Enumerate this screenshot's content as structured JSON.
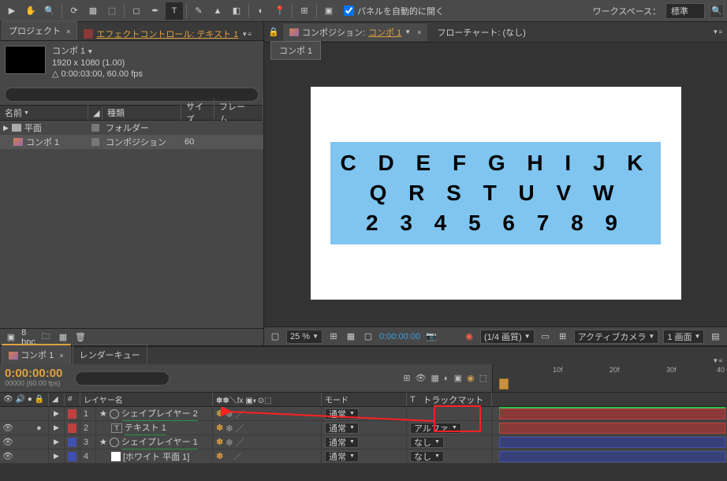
{
  "toolbar": {
    "auto_open_label": "パネルを自動的に開く",
    "workspace_label": "ワークスペース：",
    "workspace_value": "標準"
  },
  "project": {
    "tab_label": "プロジェクト",
    "fx_tab_label": "エフェクトコントロール: テキスト 1",
    "comp_name": "コンポ 1",
    "dimensions": "1920 x 1080 (1.00)",
    "duration": "0:00:03:00, 60.00 fps",
    "columns": {
      "name": "名前",
      "type": "種類",
      "size": "サイズ",
      "frame": "フレーム..."
    },
    "items": [
      {
        "name": "平面",
        "type": "フォルダー",
        "size": "",
        "kind": "folder"
      },
      {
        "name": "コンポ 1",
        "type": "コンポジション",
        "size": "60",
        "kind": "comp"
      }
    ],
    "bpc": "8 bpc"
  },
  "composition": {
    "tab_prefix": "コンポジション:",
    "tab_comp": "コンポ 1",
    "flowchart": "フローチャート: (なし)",
    "subtab": "コンポ 1",
    "text_lines": [
      "C D E F G H I J K",
      "Q R S T U V W",
      "2 3 4 5 6 7 8 9"
    ]
  },
  "viewer_footer": {
    "zoom": "25 %",
    "time": "0:00:00:00",
    "quality": "(1/4 画質)",
    "camera": "アクティブカメラ",
    "views": "1 画面"
  },
  "timeline": {
    "tab_comp": "コンポ 1",
    "tab_render": "レンダーキュー",
    "time_main": "0:00:00:00",
    "time_sub": "00000 (60.00 fps)",
    "cols": {
      "layer": "レイヤー名",
      "mode": "モード",
      "trackmatte_short": "T",
      "trackmatte": "トラックマット"
    },
    "mode_normal": "通常",
    "trk_alpha": "アルファ",
    "trk_none": "なし",
    "ruler": [
      {
        "label": "",
        "pos": 8
      },
      {
        "label": "10f",
        "pos": 80
      },
      {
        "label": "20f",
        "pos": 152
      },
      {
        "label": "30f",
        "pos": 224
      },
      {
        "label": "40",
        "pos": 290
      }
    ],
    "layers": [
      {
        "num": "1",
        "name": "シェイプレイヤー 2",
        "color": "red",
        "icon": "shape",
        "star": true,
        "mode": "",
        "trk": ""
      },
      {
        "num": "2",
        "name": "テキスト 1",
        "color": "red",
        "icon": "text",
        "star": false,
        "mode": "通常",
        "trk": "アルファ"
      },
      {
        "num": "3",
        "name": "シェイプレイヤー 1",
        "color": "blue",
        "icon": "shape",
        "star": true,
        "mode": "通常",
        "trk": "なし"
      },
      {
        "num": "4",
        "name": "[ホワイト 平面 1]",
        "color": "blue",
        "icon": "solid",
        "star": false,
        "mode": "通常",
        "trk": "なし"
      }
    ]
  }
}
